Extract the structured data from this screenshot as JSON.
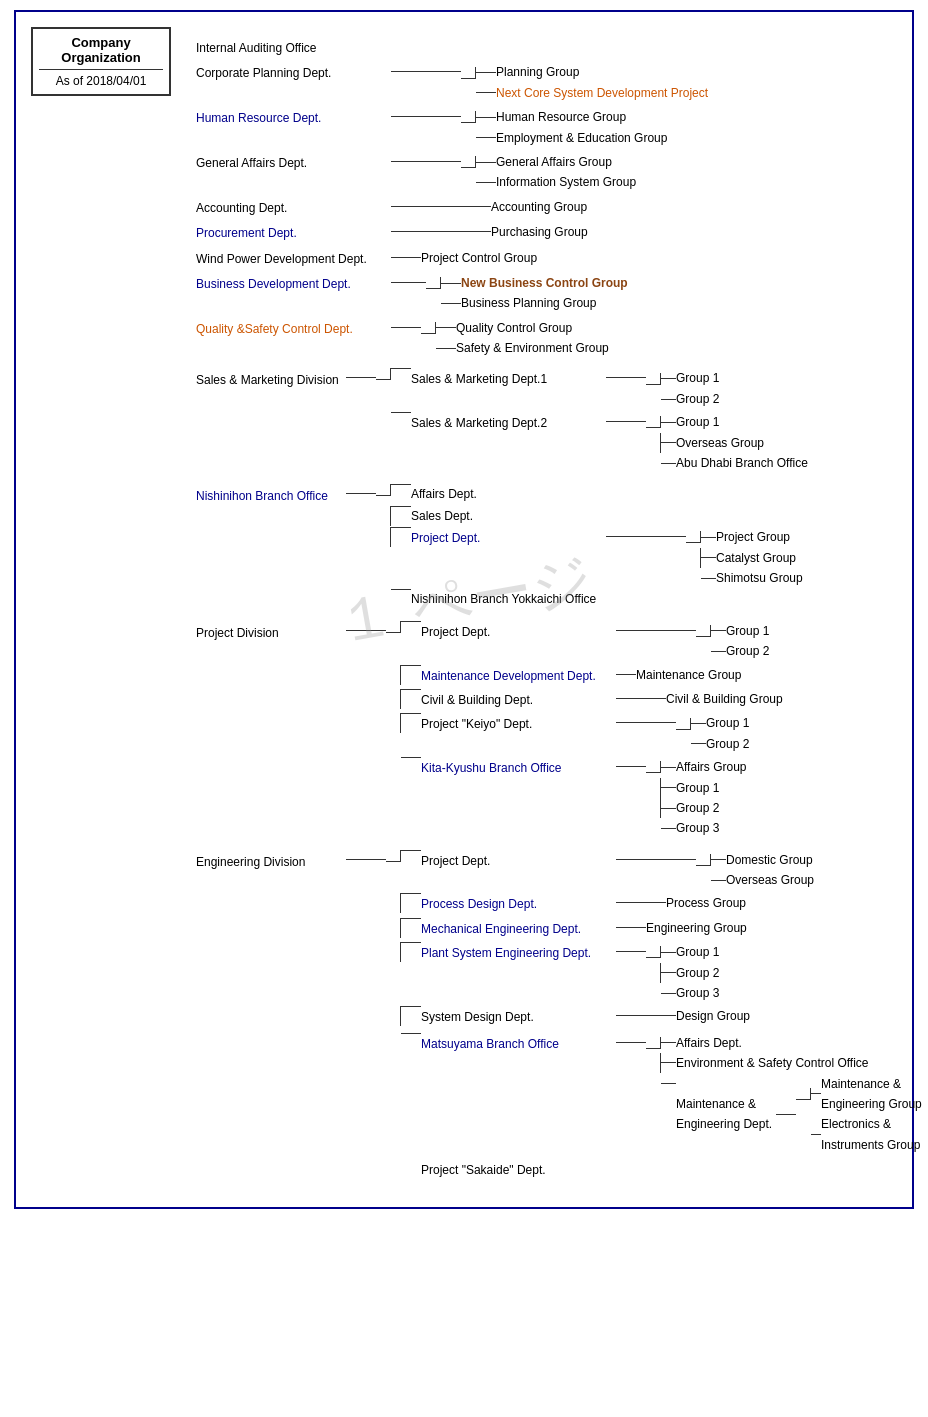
{
  "title": {
    "line1": "Company",
    "line2": "Organization",
    "date": "As of 2018/04/01"
  },
  "topLevel": [
    {
      "name": "Internal Auditing Office",
      "color": "black"
    },
    {
      "name": "Corporate Planning Dept.",
      "color": "black"
    },
    {
      "name": "Human Resource Dept.",
      "color": "blue"
    },
    {
      "name": "General Affairs Dept.",
      "color": "black"
    },
    {
      "name": "Accounting Dept.",
      "color": "black"
    },
    {
      "name": "Procurement Dept.",
      "color": "blue"
    },
    {
      "name": "Wind Power Development Dept.",
      "color": "black"
    },
    {
      "name": "Business Development Dept.",
      "color": "blue"
    },
    {
      "name": "Quality &Safety Control Dept.",
      "color": "orange"
    }
  ],
  "divisions": [
    {
      "name": "Sales & Marketing Division",
      "color": "black"
    },
    {
      "name": "Nishinihon Branch Office",
      "color": "blue"
    },
    {
      "name": "Project Division",
      "color": "black"
    },
    {
      "name": "Engineering Division",
      "color": "black"
    }
  ]
}
